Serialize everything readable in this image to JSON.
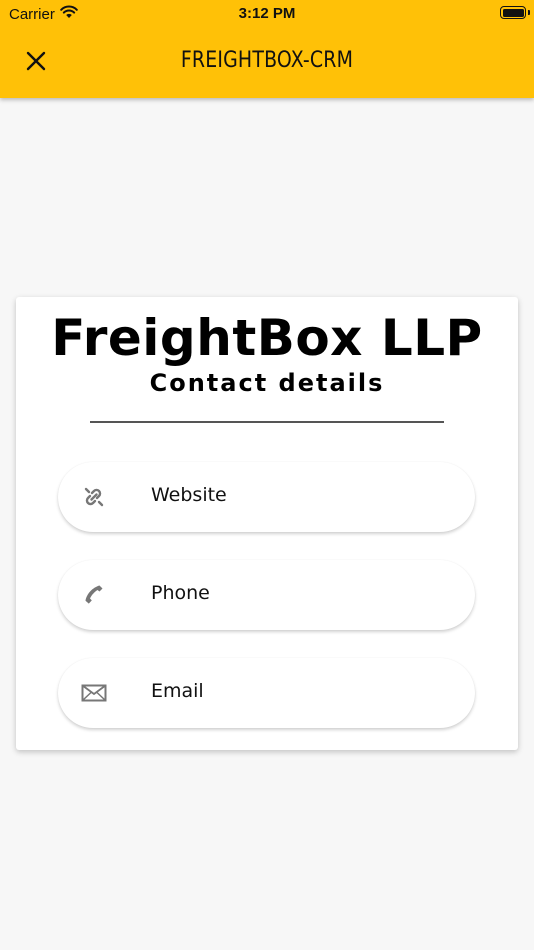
{
  "status_bar": {
    "carrier": "Carrier",
    "time": "3:12 PM",
    "wifi_icon": "wifi-icon",
    "battery_icon": "battery-icon"
  },
  "header": {
    "title": "FREIGHTBOX-CRM",
    "close_icon": "close-icon",
    "background_color": "#ffc107"
  },
  "card": {
    "company_name": "FreightBox LLP",
    "section_title": "Contact details",
    "items": [
      {
        "label": "Website",
        "icon": "link-icon"
      },
      {
        "label": "Phone",
        "icon": "phone-icon"
      },
      {
        "label": "Email",
        "icon": "mail-icon"
      }
    ]
  }
}
